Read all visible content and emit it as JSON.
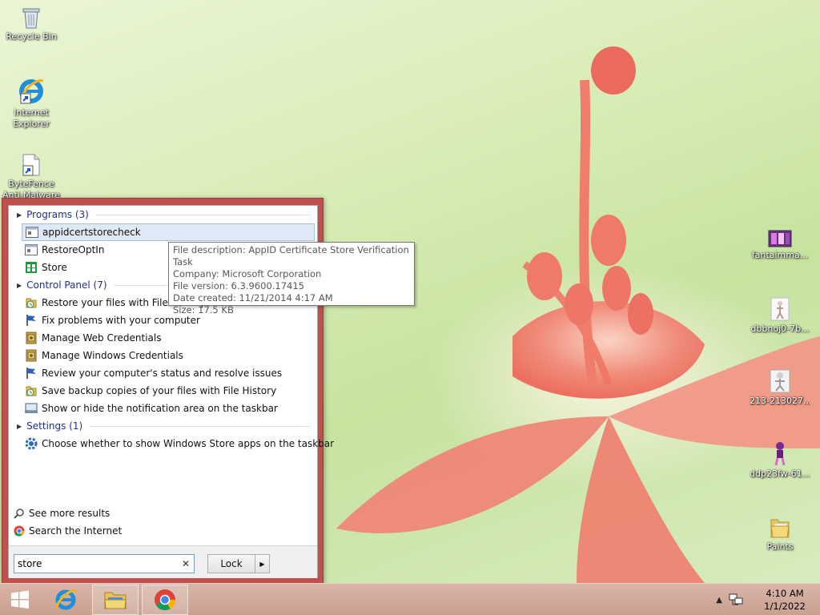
{
  "desktop": {
    "left_icons": [
      {
        "label": "Recycle Bin"
      },
      {
        "label_line1": "Internet",
        "label_line2": "Explorer"
      },
      {
        "label_line1": "ByteFence",
        "label_line2": "Anti-Malware"
      }
    ],
    "right_icons": [
      {
        "label": "fantaimma..."
      },
      {
        "label": "dbbnoj0-7b..."
      },
      {
        "label": "213-213027..."
      },
      {
        "label": "ddp23fw-61..."
      },
      {
        "label": "Paints"
      }
    ]
  },
  "search": {
    "groups": [
      {
        "title": "Programs (3)",
        "items": [
          {
            "label": "appidcertstorecheck",
            "icon": "app-window-icon",
            "selected": true
          },
          {
            "label": "RestoreOptIn",
            "icon": "app-window-icon"
          },
          {
            "label": "Store",
            "icon": "store-icon"
          }
        ]
      },
      {
        "title": "Control Panel (7)",
        "items": [
          {
            "label": "Restore your files with File History",
            "icon": "file-history-icon"
          },
          {
            "label": "Fix problems with your computer",
            "icon": "action-center-flag-icon"
          },
          {
            "label": "Manage Web Credentials",
            "icon": "credential-manager-icon"
          },
          {
            "label": "Manage Windows Credentials",
            "icon": "credential-manager-icon"
          },
          {
            "label": "Review your computer's status and resolve issues",
            "icon": "action-center-flag-icon"
          },
          {
            "label": "Save backup copies of your files with File History",
            "icon": "file-history-icon"
          },
          {
            "label": "Show or hide the notification area on the taskbar",
            "icon": "notification-area-icon"
          }
        ]
      },
      {
        "title": "Settings (1)",
        "items": [
          {
            "label": "Choose whether to show Windows Store apps on the taskbar",
            "icon": "settings-gear-icon"
          }
        ]
      }
    ],
    "see_more": "See more results",
    "search_internet": "Search the Internet",
    "query": "store",
    "power_button": "Lock"
  },
  "tooltip": {
    "line1": "File description: AppID Certificate Store Verification Task",
    "line2": "Company: Microsoft Corporation",
    "line3": "File version: 6.3.9600.17415",
    "line4": "Date created: 11/21/2014 4:17 AM",
    "line5": "Size: 17.5 KB"
  },
  "taskbar": {
    "time": "4:10 AM",
    "date": "1/1/2022"
  },
  "colors": {
    "start_frame": "#c0504d",
    "taskbar": "#c9a090",
    "group_header": "#1e3287",
    "selection": "#dfe9f6"
  }
}
